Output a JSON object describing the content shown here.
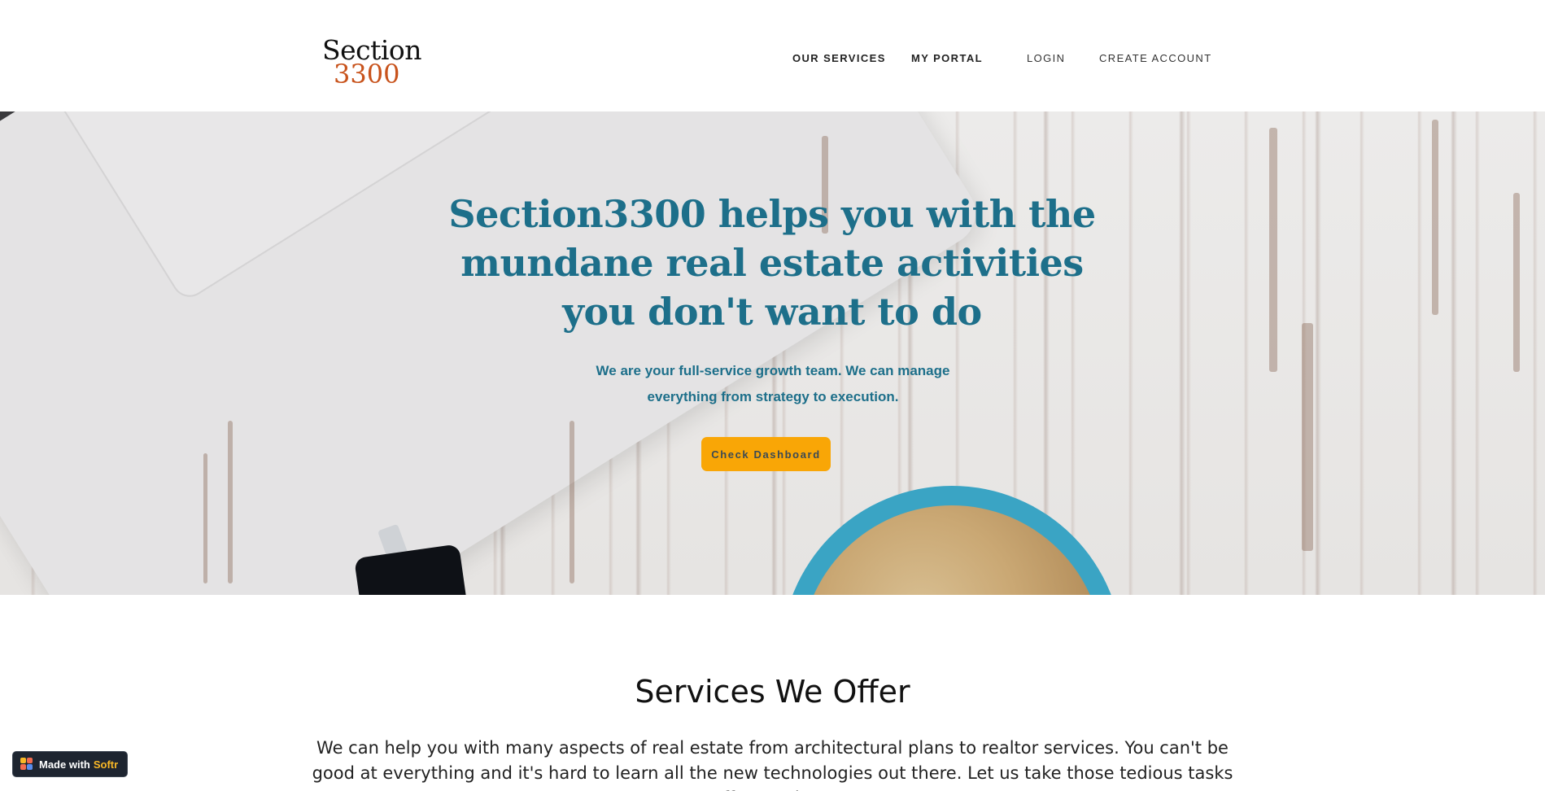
{
  "header": {
    "logo": {
      "line1": "Section",
      "line2": "3300"
    },
    "nav": [
      {
        "label": "OUR SERVICES"
      },
      {
        "label": "MY PORTAL"
      },
      {
        "label": "LOGIN"
      },
      {
        "label": "CREATE ACCOUNT"
      }
    ]
  },
  "hero": {
    "title": "Section3300 helps you with the mundane real estate activities you don't want to do",
    "subtitle": "We are your full-service growth team. We can manage everything from strategy to execution.",
    "cta_label": "Check Dashboard"
  },
  "services": {
    "title": "Services We Offer",
    "description": "We can help you with many aspects of real estate from architectural plans to realtor services. You can't be good at everything and it's hard to learn all the new technologies out there. Let us take those tedious tasks off your plate."
  },
  "badge": {
    "made_with": "Made with",
    "brand": "Softr"
  },
  "colors": {
    "accent": "#1d6f8a",
    "cta": "#f9a606",
    "logo_number": "#c8531c",
    "badge_bg": "#1e2530"
  }
}
